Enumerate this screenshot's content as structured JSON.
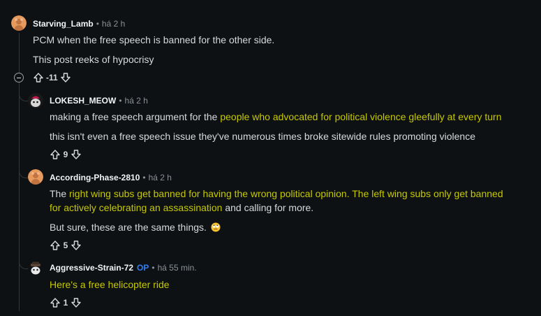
{
  "comments": [
    {
      "author": "Starving_Lamb",
      "time": "há 2 h",
      "paragraphs": [
        "PCM when the free speech is banned for the other side.",
        "This post reeks of hypocrisy"
      ],
      "score": "-11"
    },
    {
      "author": "LOKESH_MEOW",
      "time": "há 2 h",
      "p1_text": "making a free speech argument for the ",
      "p1_highlight": "people who advocated for political violence gleefully at every turn",
      "p2_text": "this isn't even a free speech issue they've numerous times broke sitewide rules promoting violence",
      "score": "9"
    },
    {
      "author": "According-Phase-2810",
      "time": "há 2 h",
      "p1_prefix": "The ",
      "p1_highlight": "right wing subs get banned for having the wrong political opinion. The left wing subs only get banned",
      "p1b_highlight": "for actively celebrating an assassination",
      "p1b_suffix": " and calling for more.",
      "p2_text": "But sure, these are the same things.",
      "p2_emoji": "eye-roll-emoji",
      "score": "5"
    },
    {
      "author": "Aggressive-Strain-72",
      "badge": "OP",
      "time": "há 55 min.",
      "p1_highlight": "Here's a free helicopter ride",
      "score": "1"
    }
  ],
  "separator": "•",
  "colors": {
    "background": "#0e1113",
    "text": "#d7dadc",
    "muted": "#8b9196",
    "highlight": "#c6c900",
    "op_badge": "#2e7ff8",
    "thread_line": "#343536"
  },
  "icons": [
    "upvote-icon",
    "downvote-icon",
    "collapse-thread-icon"
  ]
}
